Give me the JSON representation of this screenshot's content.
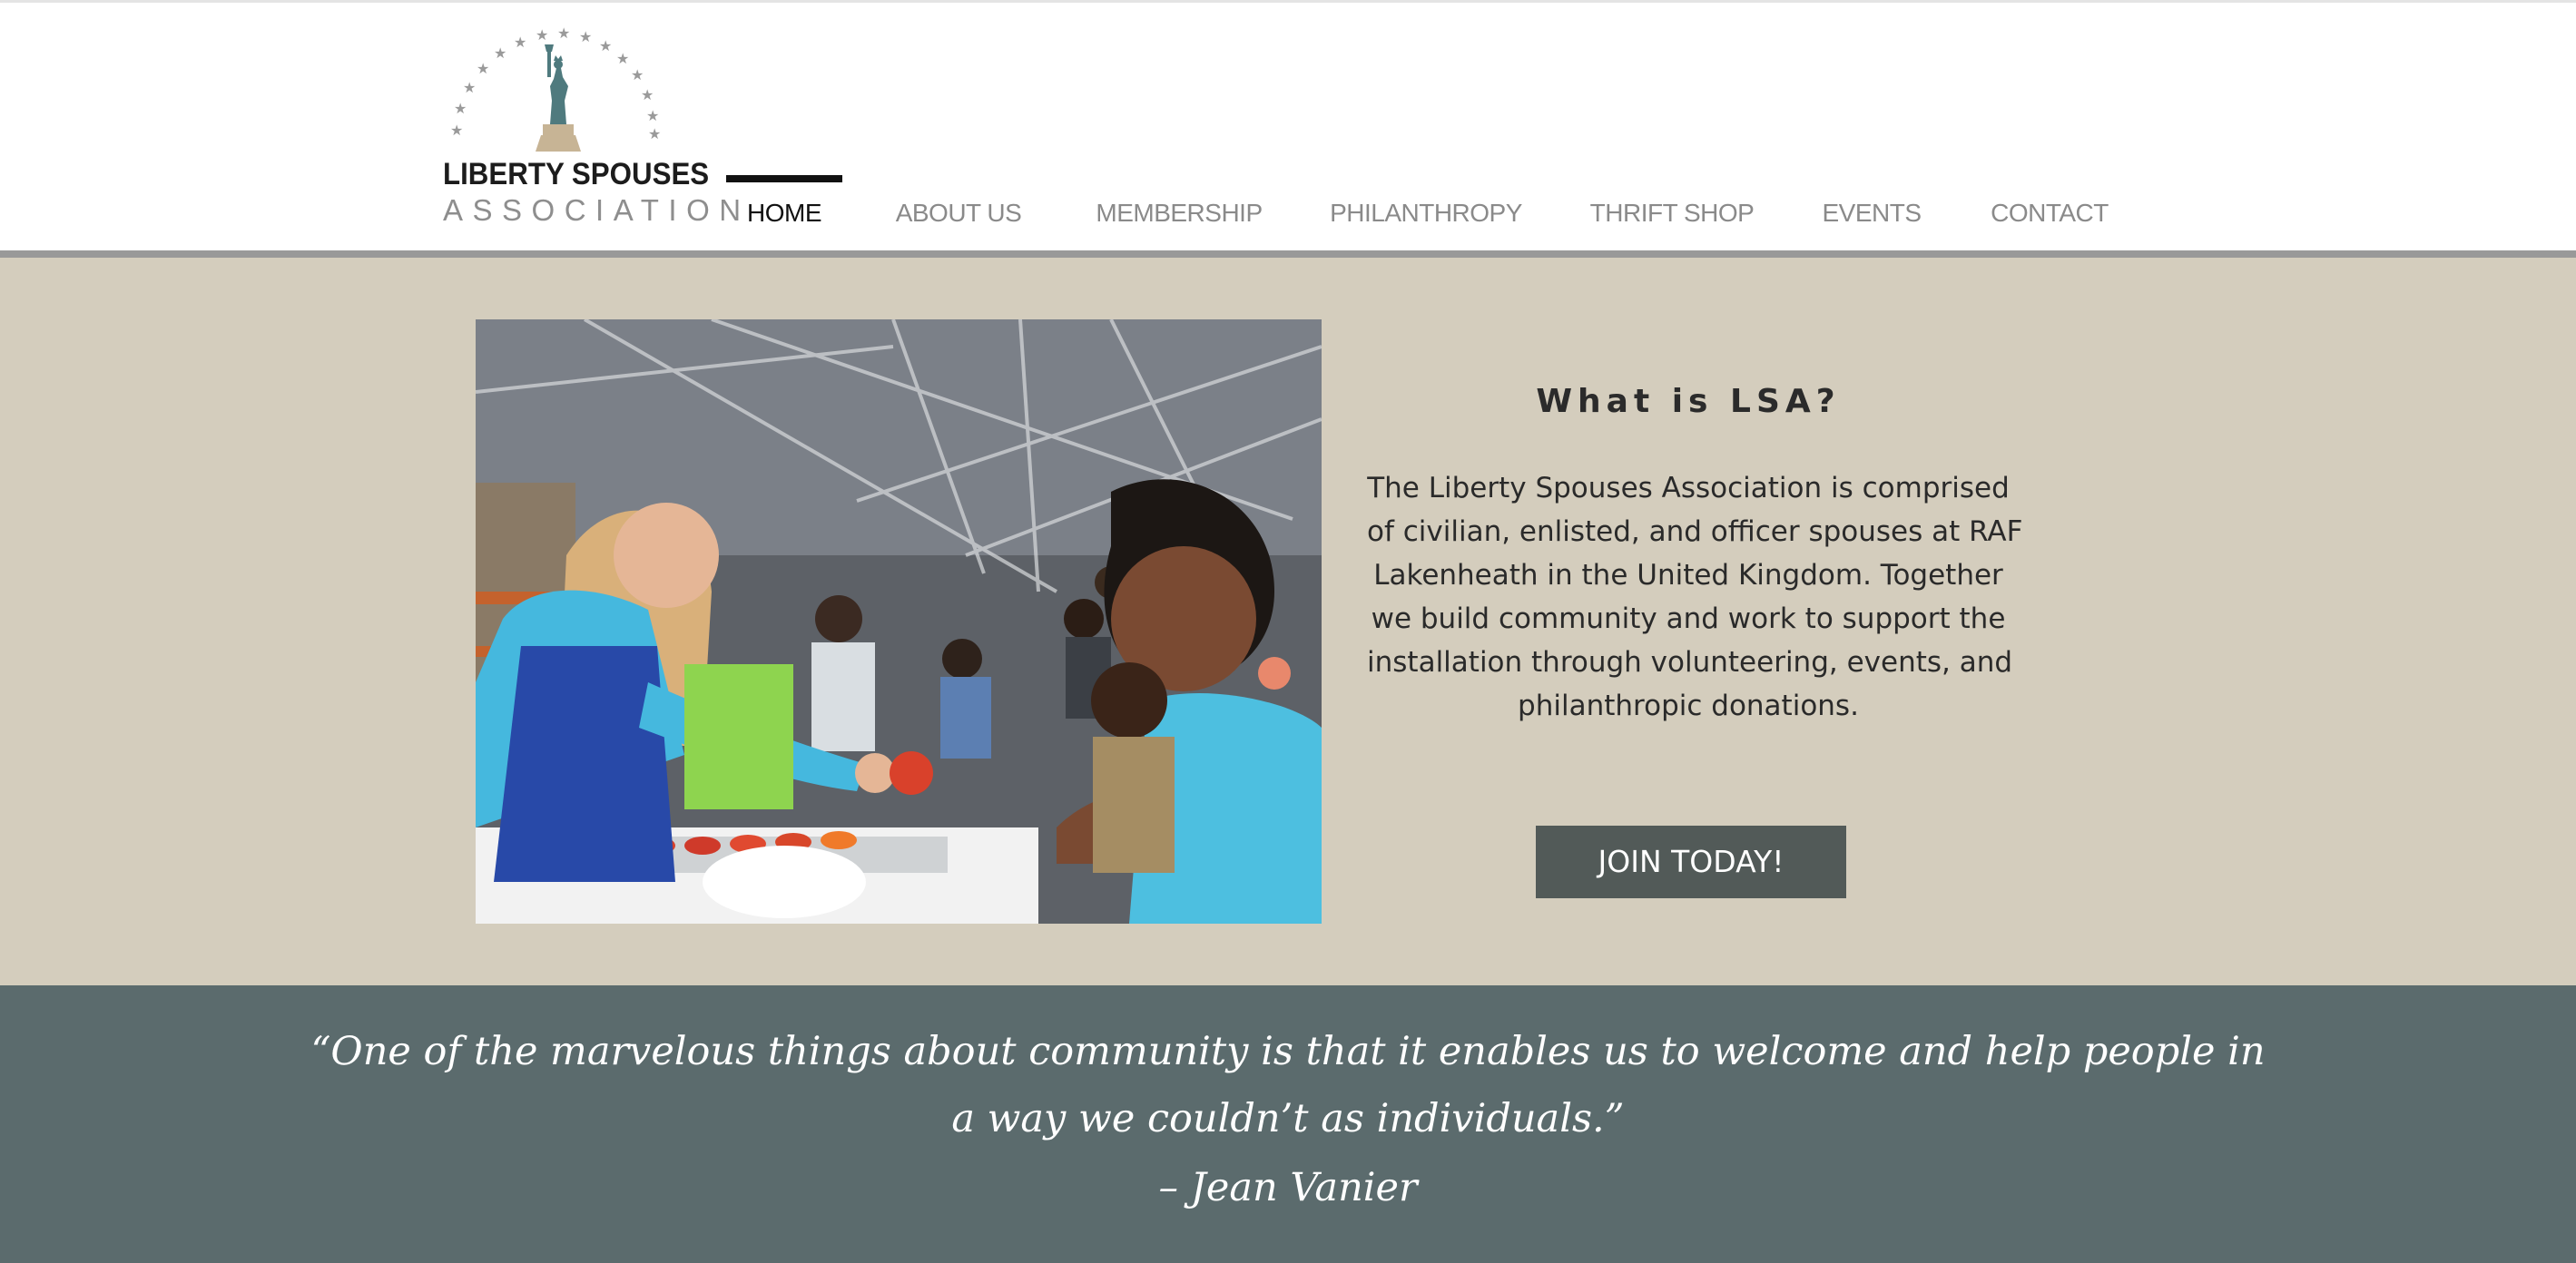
{
  "header": {
    "logo": {
      "line1": "LIBERTY SPOUSES",
      "line2": "ASSOCIATION",
      "icon": "statue-of-liberty-icon"
    },
    "nav": {
      "items": [
        {
          "label": "HOME",
          "active": true
        },
        {
          "label": "ABOUT US",
          "active": false
        },
        {
          "label": "MEMBERSHIP",
          "active": false
        },
        {
          "label": "PHILANTHROPY",
          "active": false
        },
        {
          "label": "THRIFT SHOP",
          "active": false
        },
        {
          "label": "EVENTS",
          "active": false
        },
        {
          "label": "CONTACT",
          "active": false
        }
      ]
    }
  },
  "hero": {
    "title": "What is LSA?",
    "description_lines": [
      "The Liberty Spouses Association is comprised",
      "of civilian, enlisted, and officer spouses at RAF",
      "Lakenheath in the United Kingdom.  Together",
      "we build community and work to support the",
      "installation through volunteering, events, and",
      "philanthropic donations."
    ],
    "cta_label": "JOIN TODAY!"
  },
  "quote": {
    "lines": [
      "“One of the marvelous things about community is that it enables us to welcome and help people in",
      "a way we couldn’t as individuals.”"
    ],
    "author": "–  Jean Vanier"
  },
  "colors": {
    "hero_background": "#d4cdbd",
    "quote_background": "#5b6b6d",
    "button_background": "#525a58",
    "nav_text": "#8a8a8a",
    "nav_active": "#111111"
  }
}
